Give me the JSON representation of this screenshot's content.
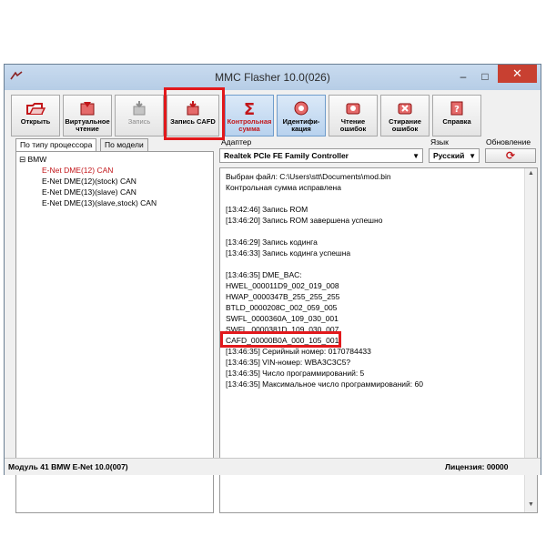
{
  "window": {
    "title": "MMC Flasher 10.0(026)"
  },
  "title_buttons": {
    "minimize": "–",
    "maximize": "□",
    "close": "✕"
  },
  "toolbar": [
    {
      "label": "Открыть",
      "icon": "folder-open-icon",
      "color": "#c2161a"
    },
    {
      "label": "Виртуальное\nчтение",
      "icon": "virtual-read-icon",
      "color": "#c2161a"
    },
    {
      "label": "Запись",
      "icon": "write-icon",
      "color": "#9a9a9a"
    },
    {
      "label": "Запись CAFD",
      "icon": "write-cafd-icon",
      "color": "#c2161a"
    },
    {
      "label": "Контрольная\nсумма",
      "icon": "sigma-icon",
      "color": "#c2161a"
    },
    {
      "label": "Идентифи-\nкация",
      "icon": "identify-icon",
      "color": "#c2161a"
    },
    {
      "label": "Чтение\nошибок",
      "icon": "read-errors-icon",
      "color": "#c2161a"
    },
    {
      "label": "Стирание\nошибок",
      "icon": "erase-errors-icon",
      "color": "#c2161a"
    },
    {
      "label": "Справка",
      "icon": "help-icon",
      "color": "#c2161a"
    }
  ],
  "tabs": {
    "by_processor": "По типу процессора",
    "by_model": "По модели"
  },
  "tree": {
    "root": "BMW",
    "items": [
      "E-Net DME(12) CAN",
      "E-Net DME(12)(stock) CAN",
      "E-Net DME(13)(slave) CAN",
      "E-Net DME(13)(slave,stock) CAN"
    ],
    "selected_color": "#c2161a"
  },
  "adapter": {
    "label": "Адаптер",
    "value": "Realtek PCIe FE Family Controller"
  },
  "language": {
    "label": "Язык",
    "value": "Русский"
  },
  "update": {
    "label": "Обновление"
  },
  "log": [
    "Выбран файл: C:\\Users\\stt\\Documents\\mod.bin",
    "Контрольная сумма исправлена",
    "",
    "[13:42:46] Запись ROM",
    "[13:46:20] Запись ROM завершена успешно",
    "",
    "[13:46:29] Запись кодинга",
    "[13:46:33] Запись кодинга успешна",
    "",
    "[13:46:35] DME_BAC:",
    " HWEL_000011D9_002_019_008",
    " HWAP_0000347B_255_255_255",
    " BTLD_0000208C_002_059_005",
    " SWFL_0000360A_109_030_001",
    " SWFL_0000381D_109_030_007",
    " CAFD_00000B0A_000_105_001",
    "[13:46:35] Серийный номер: 0170784433",
    "[13:46:35] VIN-номер: WBA3C3C5?",
    "[13:46:35] Число программирований: 5",
    "[13:46:35] Максимальное число программирований: 60"
  ],
  "status": {
    "module": "Модуль 41 BMW E-Net 10.0(007)",
    "license": "Лицензия: 00000"
  },
  "colors": {
    "highlight": "#e2191c",
    "accent": "#c2161a"
  }
}
